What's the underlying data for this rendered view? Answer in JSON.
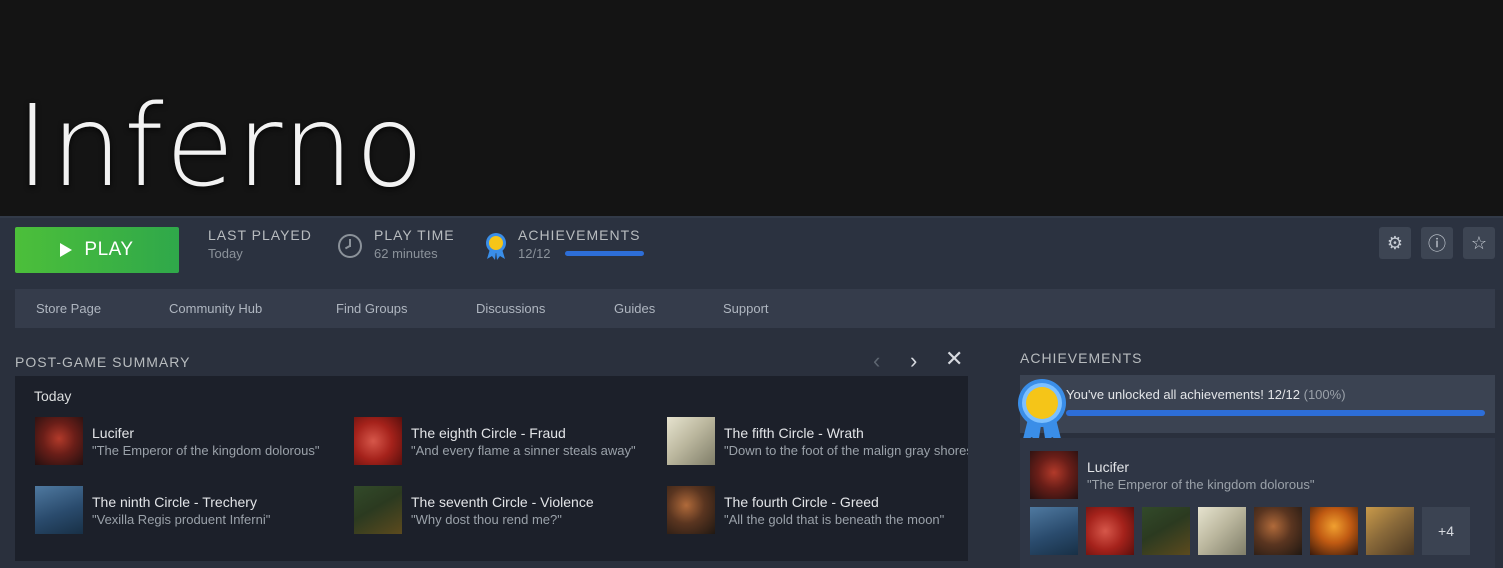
{
  "game": {
    "title": "Inferno"
  },
  "topbar": {
    "play_label": "PLAY",
    "last_played_label": "LAST PLAYED",
    "last_played_value": "Today",
    "play_time_label": "PLAY TIME",
    "play_time_value": "62 minutes",
    "achievements_label": "ACHIEVEMENTS",
    "achievements_value": "12/12",
    "achievements_progress": 1.0
  },
  "toolbar_icons": [
    "gear-icon",
    "info-icon",
    "star-icon"
  ],
  "nav": {
    "items": [
      "Store Page",
      "Community Hub",
      "Find Groups",
      "Discussions",
      "Guides",
      "Support"
    ]
  },
  "summary": {
    "title": "POST-GAME SUMMARY",
    "date": "Today",
    "items": [
      {
        "name": "Lucifer",
        "desc": "\"The Emperor of the kingdom dolorous\""
      },
      {
        "name": "The eighth Circle - Fraud",
        "desc": "\"And every flame a sinner steals away\""
      },
      {
        "name": "The fifth Circle - Wrath",
        "desc": "\"Down to the foot of the malign gray shores\""
      },
      {
        "name": "The ninth Circle - Trechery",
        "desc": "\"Vexilla Regis produent Inferni\""
      },
      {
        "name": "The seventh Circle - Violence",
        "desc": "\"Why dost thou rend me?\""
      },
      {
        "name": "The fourth Circle - Greed",
        "desc": "\"All the gold that is beneath the moon\""
      }
    ]
  },
  "achievements_panel": {
    "title": "ACHIEVEMENTS",
    "unlocked_text": "You've unlocked all achievements! 12/12",
    "unlocked_pct": "(100%)",
    "progress": 1.0,
    "latest": {
      "name": "Lucifer",
      "desc": "\"The Emperor of the kingdom dolorous\""
    },
    "more_count": "+4"
  },
  "colors": {
    "accent_blue": "#2d6ed8",
    "play_green": "#4cbf3a",
    "medal_gold": "#f5c518"
  }
}
